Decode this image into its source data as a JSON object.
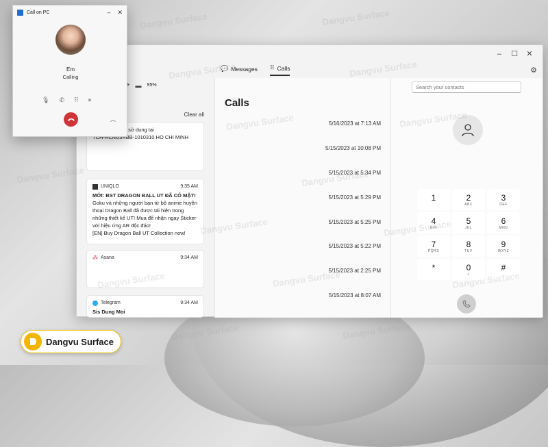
{
  "popup": {
    "title": "Call on PC",
    "caller_name": "Em",
    "caller_status": "Calling",
    "minimize": "–",
    "close": "✕"
  },
  "window": {
    "app_title_fragment": "s",
    "tabs": [
      {
        "label": "Messages",
        "active": false
      },
      {
        "label": "Calls",
        "active": true
      }
    ],
    "battery": "95%"
  },
  "notifications": {
    "clear_all": "Clear all",
    "cards": [
      {
        "app": "",
        "time": "",
        "title": "",
        "body": "...12975...7901 sử dụng tại\nTCH-HCM03RBB-1010310 HO CHI MINH"
      },
      {
        "app": "UNIQLO",
        "time": "9:35 AM",
        "title": "MỚI: BST DRAGON BALL UT ĐÃ CÓ MẶT!",
        "body": "Goku và những người bạn từ bộ anime huyền thoại Dragon Ball đã được tái hiện trong những thiết kế UT! Mua để nhận ngay Sticker với hiệu ứng AR độc đáo!\n[EN] Buy Dragon Ball UT Collection now!"
      },
      {
        "app": "Asana",
        "time": "9:34 AM",
        "title": "",
        "body": ""
      },
      {
        "app": "Telegram",
        "time": "9:34 AM",
        "title": "Sis Dung Moi",
        "body": ""
      }
    ]
  },
  "calls": {
    "title": "Calls",
    "entries": [
      "5/16/2023 at 7:13 AM",
      "5/15/2023 at 10:08 PM",
      "5/15/2023 at 5:34 PM",
      "5/15/2023 at 5:29 PM",
      "5/15/2023 at 5:25 PM",
      "5/15/2023 at 5:22 PM",
      "5/15/2023 at 2:25 PM",
      "5/15/2023 at 8:07 AM"
    ]
  },
  "dialer": {
    "search_placeholder": "Search your contacts",
    "keys": [
      {
        "num": "1",
        "sub": ""
      },
      {
        "num": "2",
        "sub": "ABC"
      },
      {
        "num": "3",
        "sub": "DEF"
      },
      {
        "num": "4",
        "sub": "GHI"
      },
      {
        "num": "5",
        "sub": "JKL"
      },
      {
        "num": "6",
        "sub": "MNO"
      },
      {
        "num": "7",
        "sub": "PQRS"
      },
      {
        "num": "8",
        "sub": "TUV"
      },
      {
        "num": "9",
        "sub": "WXYZ"
      },
      {
        "num": "*",
        "sub": ""
      },
      {
        "num": "0",
        "sub": "+"
      },
      {
        "num": "#",
        "sub": ""
      }
    ]
  },
  "brand": {
    "name": "Dangvu Surface",
    "watermark": "Dangvu Surface"
  },
  "colors": {
    "hangup": "#d13438",
    "brand_yellow": "#f4b400",
    "popup_icon": "#1f6fd1"
  }
}
